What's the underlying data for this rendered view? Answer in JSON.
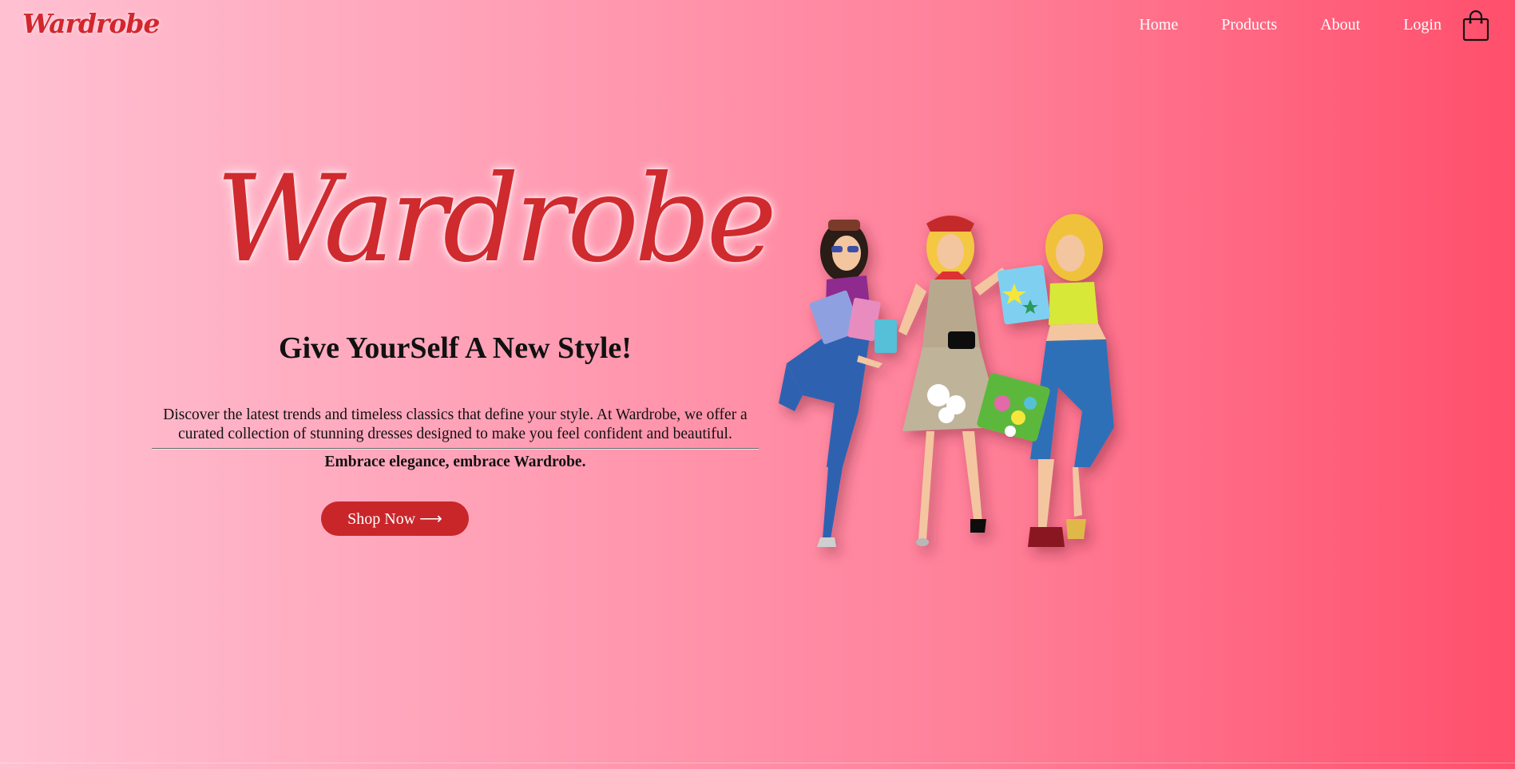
{
  "nav": {
    "logo": "Wardrobe",
    "links": [
      "Home",
      "Products",
      "About",
      "Login"
    ],
    "cart_icon": "shopping-bag-icon"
  },
  "hero": {
    "logo": "Wardrobe",
    "tagline": "Give YourSelf A New Style!",
    "description": "Discover the latest trends and timeless classics that define your style. At Wardrobe, we offer a curated collection of stunning dresses designed to make you feel confident and beautiful.",
    "emphasis": "Embrace elegance, embrace Wardrobe.",
    "cta": "Shop Now ⟶"
  },
  "colors": {
    "brand": "#cf2a2e",
    "button": "#c9262a",
    "gradient_start": "#ffc1d2",
    "gradient_end": "#ff4f6c"
  }
}
